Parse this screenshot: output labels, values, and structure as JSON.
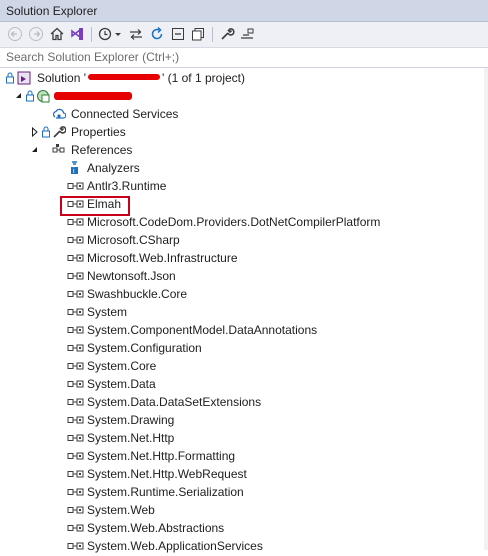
{
  "window": {
    "title": "Solution Explorer"
  },
  "search": {
    "placeholder": "Search Solution Explorer (Ctrl+;)"
  },
  "toolbar": {
    "icons": [
      "back-icon",
      "forward-icon",
      "home-icon",
      "vs-switch-icon",
      "history-icon",
      "sync-icon",
      "refresh-icon",
      "collapse-all-icon",
      "show-all-files-icon",
      "properties-wrench-icon",
      "preview-icon"
    ]
  },
  "tree": {
    "solution_prefix": "Solution '",
    "solution_suffix": "' (1 of 1 project)",
    "connected_services": "Connected Services",
    "properties": "Properties",
    "references": "References",
    "analyzers": "Analyzers",
    "refs": [
      "Antlr3.Runtime",
      "Elmah",
      "Microsoft.CodeDom.Providers.DotNetCompilerPlatform",
      "Microsoft.CSharp",
      "Microsoft.Web.Infrastructure",
      "Newtonsoft.Json",
      "Swashbuckle.Core",
      "System",
      "System.ComponentModel.DataAnnotations",
      "System.Configuration",
      "System.Core",
      "System.Data",
      "System.Data.DataSetExtensions",
      "System.Drawing",
      "System.Net.Http",
      "System.Net.Http.Formatting",
      "System.Net.Http.WebRequest",
      "System.Runtime.Serialization",
      "System.Web",
      "System.Web.Abstractions",
      "System.Web.ApplicationServices"
    ]
  },
  "colors": {
    "highlight_box": "#c8001a",
    "redaction": "#e60000",
    "titlebar": "#cfd6e5"
  }
}
